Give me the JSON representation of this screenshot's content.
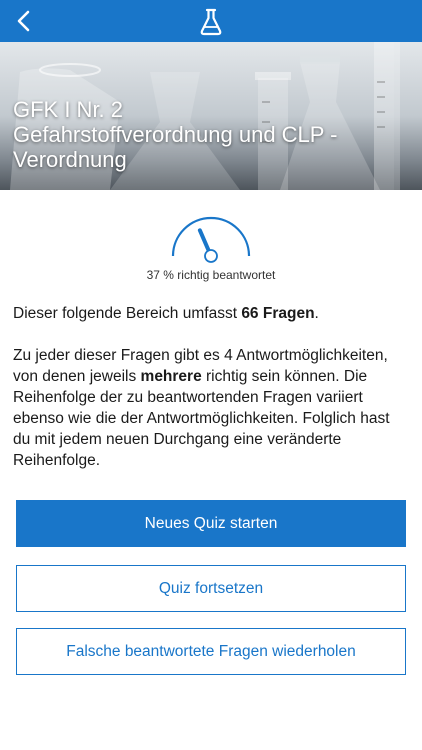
{
  "header": {
    "back_icon": "chevron-left-icon",
    "app_icon": "flask-icon",
    "color": "#1976c9"
  },
  "hero": {
    "title_line1": "GFK I Nr. 2",
    "title_line2": "Gefahrstoffverordnung und CLP -",
    "title_line3": "Verordnung",
    "image": "laboratory-glassware"
  },
  "progress": {
    "percent": 37,
    "label": "37 % richtig beantwortet"
  },
  "intro": {
    "prefix": "Dieser folgende Bereich umfasst ",
    "count_text": "66 Fragen",
    "suffix": "."
  },
  "description": {
    "part1": "Zu jeder dieser Fragen gibt es 4 Antwortmöglichkeiten, von denen jeweils ",
    "emphasis": "mehrere",
    "part2": " richtig sein können. Die Reihenfolge der zu beantwortenden Fragen variiert ebenso wie die der Antwortmöglichkeiten. Folglich hast du mit jedem neuen Durchgang eine veränderte Reihenfolge."
  },
  "buttons": {
    "new_quiz": "Neues Quiz starten",
    "continue_quiz": "Quiz fortsetzen",
    "repeat_wrong": "Falsche beantwortete Fragen wiederholen"
  }
}
